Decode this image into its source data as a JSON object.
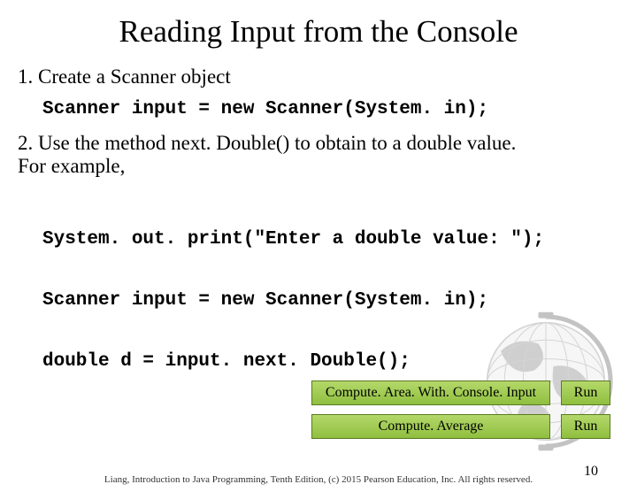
{
  "title": "Reading Input from the Console",
  "step1": "1. Create a Scanner object",
  "code1": "Scanner input = new Scanner(System. in);",
  "step2a": "2. Use the method next. Double() to obtain to a double value.",
  "step2b": "For example,",
  "code2_line1": "System. out. print(\"Enter a double value: \");",
  "code2_line2": "Scanner input = new Scanner(System. in);",
  "code2_line3": "double d = input. next. Double();",
  "buttons": {
    "prog1": "Compute. Area. With. Console. Input",
    "run1": "Run",
    "prog2": "Compute. Average",
    "run2": "Run"
  },
  "footer": "Liang, Introduction to Java Programming, Tenth Edition, (c) 2015 Pearson Education, Inc. All rights reserved.",
  "pagenum": "10"
}
